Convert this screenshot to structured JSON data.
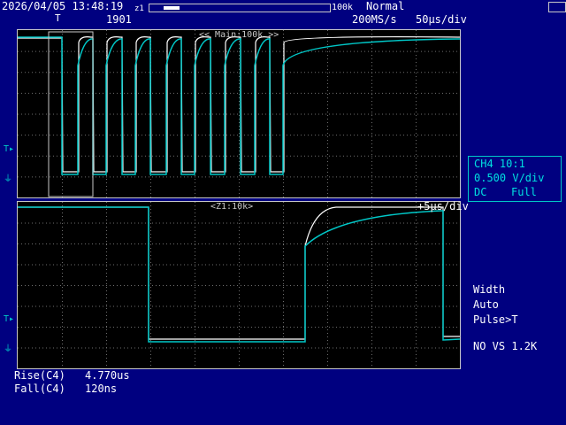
{
  "header": {
    "datetime": "2026/04/05 13:48:19",
    "zoom_indicator": "z1",
    "acq_count": "1901",
    "memory_label": "100k",
    "trigger_mode": "Normal",
    "sample_rate": "200MS/s",
    "timebase": "50μs/div"
  },
  "main_window": {
    "label": "<< Main:100k >>"
  },
  "zoom_window": {
    "label": "<Z1:10k>",
    "timebase": "+5μs/div"
  },
  "channel": {
    "name_scale": "CH4 10:1",
    "vdiv": "0.500 V/div",
    "coupling": "DC",
    "bandwidth": "Full",
    "color": "#00c8c8"
  },
  "trigger": {
    "type": "Width",
    "mode": "Auto",
    "condition": "Pulse>T"
  },
  "note": "NO VS 1.2K",
  "measurements": [
    {
      "label": "Rise(C4)",
      "value": "4.770us"
    },
    {
      "label": "Fall(C4)",
      "value": "120ns"
    }
  ],
  "trace_colors": {
    "ch4": "#00c8c8",
    "reference": "#ffffff",
    "grid": "#6e6e6e"
  }
}
